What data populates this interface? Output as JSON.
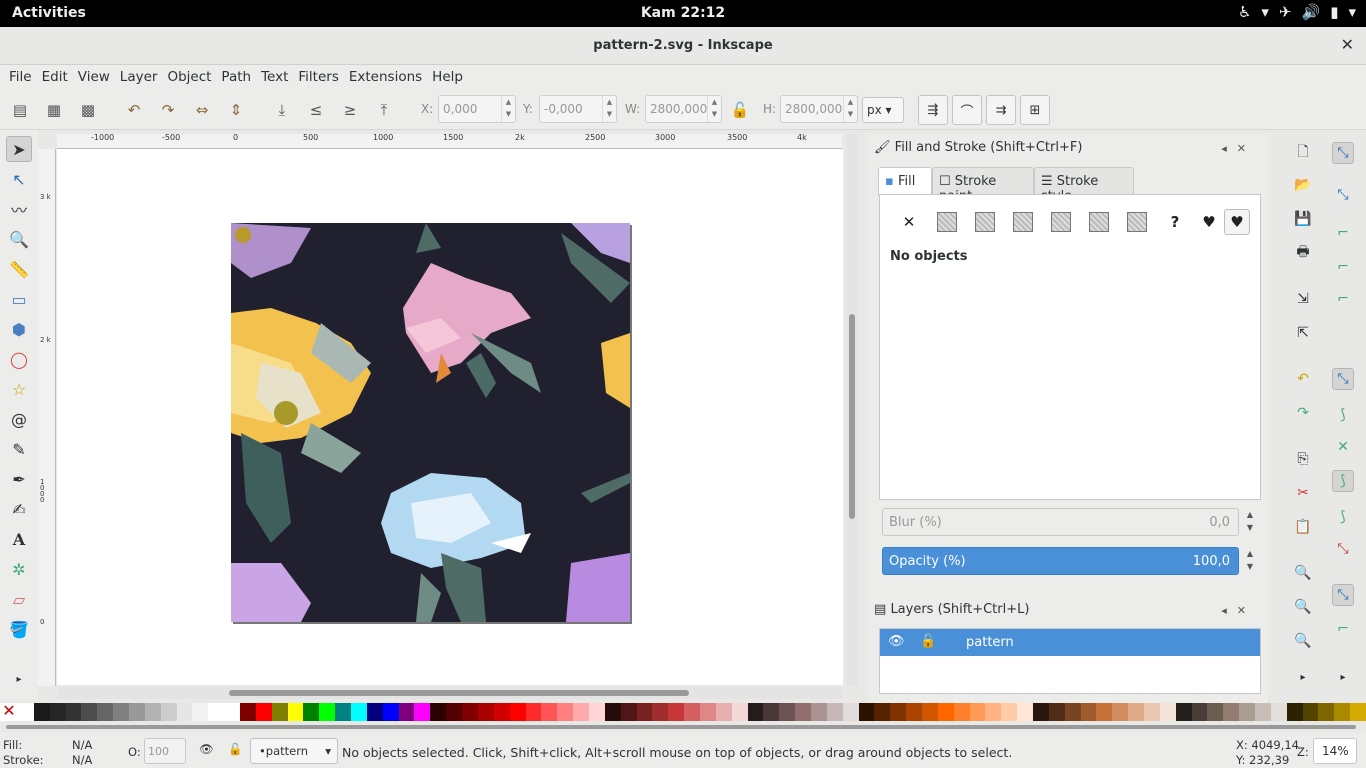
{
  "topbar": {
    "activities": "Activities",
    "clock": "Kam 22:12",
    "tray": [
      "accessibility-icon",
      "chevron-down-icon",
      "airplane-icon",
      "volume-icon",
      "battery-icon",
      "chevron-down-icon"
    ]
  },
  "window": {
    "title": "pattern-2.svg - Inkscape",
    "close": "✕"
  },
  "menu": [
    "File",
    "Edit",
    "View",
    "Layer",
    "Object",
    "Path",
    "Text",
    "Filters",
    "Extensions",
    "Help"
  ],
  "toolbar": {
    "x_label": "X:",
    "x_value": "0,000",
    "y_label": "Y:",
    "y_value": "-0,000",
    "w_label": "W:",
    "w_value": "2800,000",
    "h_label": "H:",
    "h_value": "2800,000",
    "unit": "px"
  },
  "ruler": {
    "h_ticks": [
      "-1000",
      "-500",
      "0",
      "500",
      "1000",
      "1500",
      "2k",
      "2500",
      "3000",
      "3500",
      "4k"
    ],
    "v_ticks": [
      "3 k",
      "2 k",
      "1 0 0 0",
      "0"
    ]
  },
  "fill_stroke": {
    "title": "Fill and Stroke (Shift+Ctrl+F)",
    "tabs": [
      "Fill",
      "Stroke paint",
      "Stroke style"
    ],
    "no_objects": "No objects",
    "blur_label": "Blur (%)",
    "blur_value": "0,0",
    "opacity_label": "Opacity (%)",
    "opacity_value": "100,0"
  },
  "layers": {
    "title": "Layers (Shift+Ctrl+L)",
    "layer_name": "pattern"
  },
  "status": {
    "fill_label": "Fill:",
    "fill_value": "N/A",
    "stroke_label": "Stroke:",
    "stroke_value": "N/A",
    "o_label": "O:",
    "o_value": "100",
    "layer": "•pattern",
    "message": "No objects selected. Click, Shift+click, Alt+scroll mouse on top of objects, or drag around objects to select.",
    "x_coord": "X: 4049,14",
    "y_coord": "Y: 232,39",
    "z_label": "Z:",
    "zoom": "14%"
  },
  "palette": [
    "#ffffff",
    "#1a1a1a",
    "#262626",
    "#333333",
    "#4d4d4d",
    "#666666",
    "#808080",
    "#999999",
    "#b3b3b3",
    "#cccccc",
    "#e6e6e6",
    "#f2f2f2",
    "#ffffff",
    "#ffffff",
    "#800000",
    "#ff0000",
    "#808000",
    "#ffff00",
    "#008000",
    "#00ff00",
    "#008080",
    "#00ffff",
    "#000080",
    "#0000ff",
    "#800080",
    "#ff00ff",
    "#2b0000",
    "#550000",
    "#800000",
    "#aa0000",
    "#d40000",
    "#ff0000",
    "#ff2a2a",
    "#ff5555",
    "#ff8080",
    "#ffaaaa",
    "#ffd5d5",
    "#280b0b",
    "#501616",
    "#782121",
    "#a02c2c",
    "#c83737",
    "#d35f5f",
    "#de8787",
    "#e9afaf",
    "#f4d7d7",
    "#241c1c",
    "#483737",
    "#6c5353",
    "#916f6f",
    "#ac9393",
    "#c8b7b7",
    "#e3dbdb",
    "#2b1100",
    "#552200",
    "#803300",
    "#aa4400",
    "#d45500",
    "#ff6600",
    "#ff7f2a",
    "#ff9955",
    "#ffb380",
    "#ffccaa",
    "#ffe6d5",
    "#28170b",
    "#502d16",
    "#784421",
    "#a05a2c",
    "#c87137",
    "#d38d5f",
    "#deaa87",
    "#e9c6af",
    "#f4e3d7",
    "#241f1c",
    "#483e37",
    "#6c5d53",
    "#917c6f",
    "#ac9d93",
    "#c8beb7",
    "#e3dedb",
    "#2b2200",
    "#554400",
    "#806600",
    "#aa8800",
    "#d4aa00"
  ]
}
